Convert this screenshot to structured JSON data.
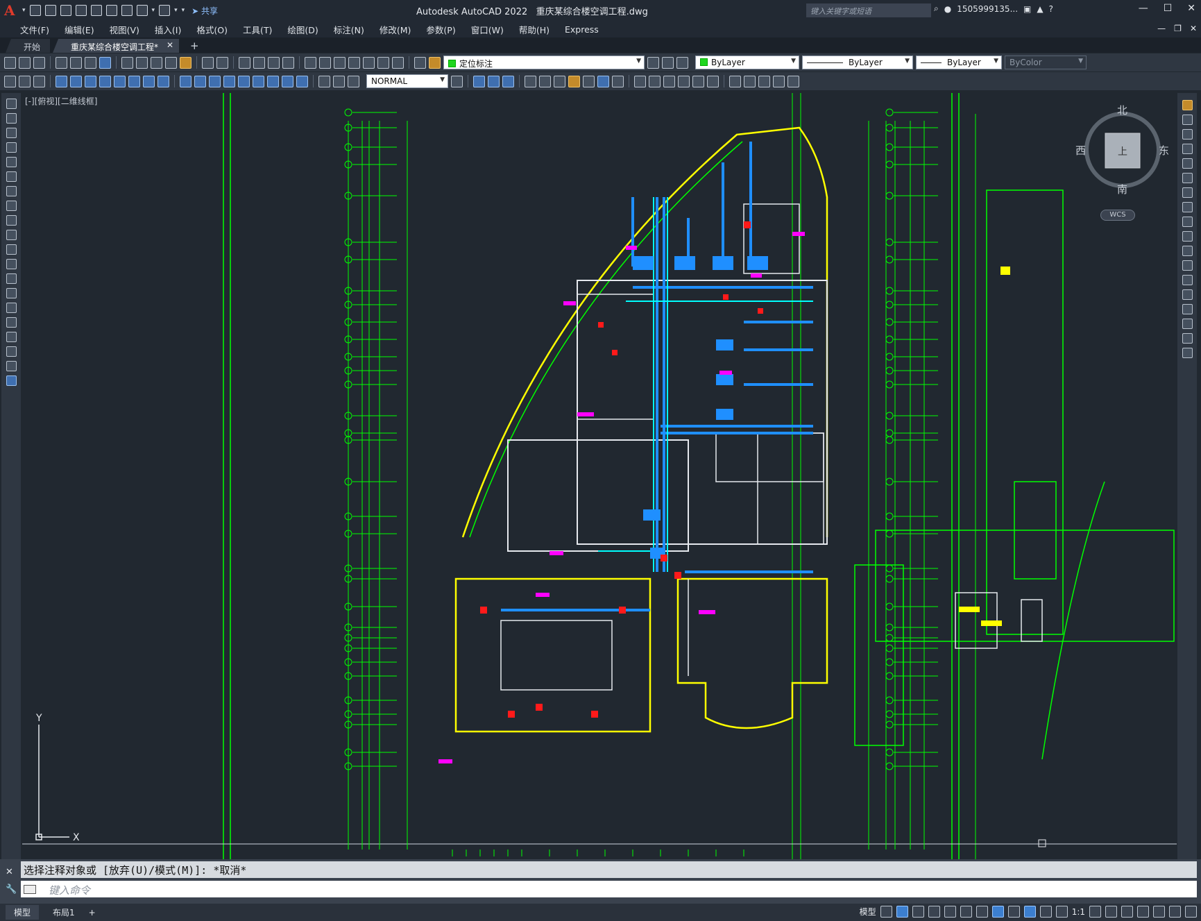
{
  "app": {
    "logo": "A",
    "share": "共享",
    "title": "Autodesk AutoCAD 2022",
    "filename": "重庆某综合楼空调工程.dwg",
    "search_placeholder": "键入关键字或短语",
    "user": "1505999135...",
    "window_buttons": [
      "—",
      "☐",
      "✕"
    ]
  },
  "menu": {
    "items": [
      "文件(F)",
      "编辑(E)",
      "视图(V)",
      "插入(I)",
      "格式(O)",
      "工具(T)",
      "绘图(D)",
      "标注(N)",
      "修改(M)",
      "参数(P)",
      "窗口(W)",
      "帮助(H)",
      "Express"
    ],
    "doc_buttons": [
      "—",
      "❐",
      "✕"
    ]
  },
  "tabs": {
    "items": [
      "开始",
      "重庆某综合楼空调工程*"
    ],
    "close": "✕",
    "add": "+"
  },
  "toolbar1": {
    "layer": "定位标注",
    "color": "ByLayer",
    "linetype": "ByLayer",
    "lineweight": "ByLayer",
    "plotstyle": "ByColor"
  },
  "toolbar2": {
    "textstyle": "NORMAL"
  },
  "viewport": {
    "label": "[-][俯视][二维线框]",
    "viewcube": {
      "north": "北",
      "south": "南",
      "west": "西",
      "east": "东",
      "top": "上",
      "wcs": "WCS"
    },
    "ucs_x": "X",
    "ucs_y": "Y"
  },
  "command": {
    "history": "选择注释对象或 [放弃(U)/模式(M)]: *取消*",
    "placeholder": "键入命令"
  },
  "status": {
    "tabs": [
      "模型",
      "布局1"
    ],
    "add": "+",
    "model": "模型",
    "scale": "1:1"
  },
  "colors": {
    "background": "#212830",
    "wall_yellow": "#ffff00",
    "axis_green": "#00ff00",
    "duct_blue": "#1f8fff",
    "duct_cyan": "#00ffff",
    "annotation_magenta": "#ff00ff",
    "equipment_red": "#ff1a1a"
  }
}
